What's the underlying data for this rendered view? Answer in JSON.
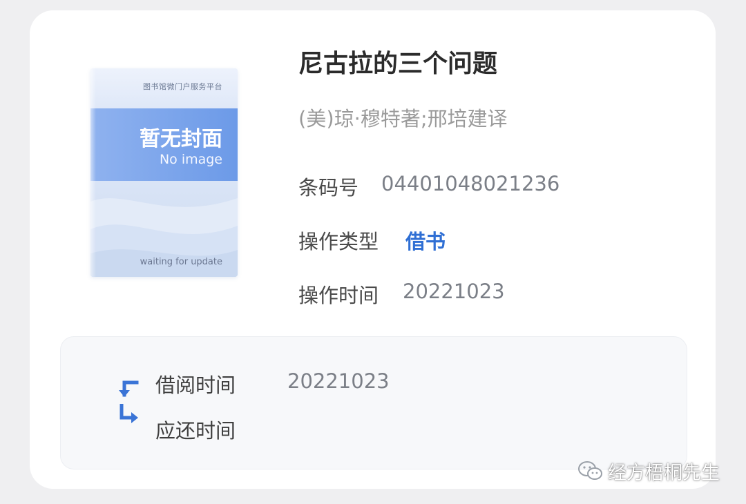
{
  "book": {
    "title": "尼古拉的三个问题",
    "author": "(美)琼·穆特著;邢培建译",
    "cover": {
      "platform_text": "图书馆微门户服务平台",
      "title_text": "暂无封面",
      "no_image_text": "No image",
      "waiting_text": "waiting for update",
      "band_color": "#6c9ae8"
    }
  },
  "details": {
    "barcode_label": "条码号",
    "barcode_value": "04401048021236",
    "op_type_label": "操作类型",
    "op_type_value": "借书",
    "op_time_label": "操作时间",
    "op_time_value": "20221023"
  },
  "borrow": {
    "borrow_time_label": "借阅时间",
    "borrow_time_value": "20221023",
    "due_time_label": "应还时间",
    "due_time_value": "",
    "icons": [
      "arrow-out-icon",
      "arrow-return-icon"
    ]
  },
  "watermark": {
    "text": "经方梧桐先生",
    "icon": "wechat-icon"
  },
  "colors": {
    "accent": "#2f6fd4",
    "background": "#efeff1",
    "card": "#ffffff",
    "panel": "#f7f8fa"
  }
}
